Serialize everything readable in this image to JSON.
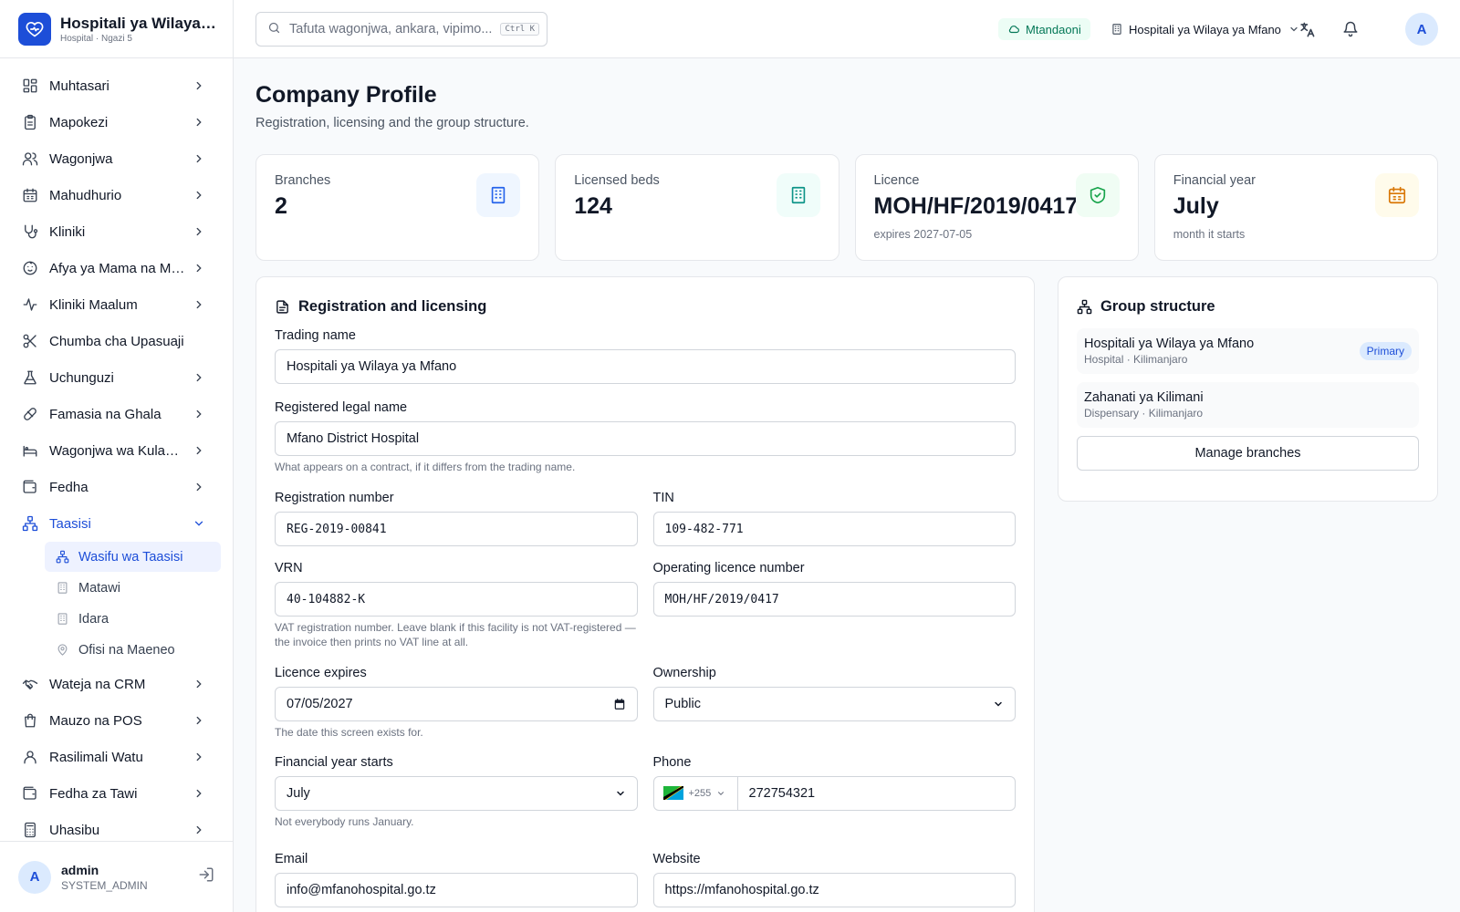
{
  "brand": {
    "name": "Hospitali ya Wilaya ya Mfano",
    "subtitle": "Hospital · Ngazi 5"
  },
  "sidebar": {
    "items": [
      {
        "label": "Muhtasari",
        "icon": "dashboard-icon"
      },
      {
        "label": "Mapokezi",
        "icon": "clipboard-icon"
      },
      {
        "label": "Wagonjwa",
        "icon": "users-icon"
      },
      {
        "label": "Mahudhurio",
        "icon": "calendar-icon"
      },
      {
        "label": "Kliniki",
        "icon": "stethoscope-icon"
      },
      {
        "label": "Afya ya Mama na Mtoto",
        "icon": "baby-icon"
      },
      {
        "label": "Kliniki Maalum",
        "icon": "activity-icon"
      },
      {
        "label": "Chumba cha Upasuaji",
        "icon": "scissors-icon"
      },
      {
        "label": "Uchunguzi",
        "icon": "flask-icon"
      },
      {
        "label": "Famasia na Ghala",
        "icon": "pill-icon"
      },
      {
        "label": "Wagonjwa wa Kulazwa",
        "icon": "bed-icon"
      },
      {
        "label": "Fedha",
        "icon": "wallet-icon"
      },
      {
        "label": "Taasisi",
        "icon": "org-icon"
      }
    ],
    "sub_items": [
      {
        "label": "Wasifu wa Taasisi",
        "icon": "org-icon"
      },
      {
        "label": "Matawi",
        "icon": "building-icon"
      },
      {
        "label": "Idara",
        "icon": "building-icon"
      },
      {
        "label": "Ofisi na Maeneo",
        "icon": "map-pin-icon"
      }
    ],
    "items_after": [
      {
        "label": "Wateja na CRM",
        "icon": "handshake-icon"
      },
      {
        "label": "Mauzo na POS",
        "icon": "shopping-bag-icon"
      },
      {
        "label": "Rasilimali Watu",
        "icon": "user-icon"
      },
      {
        "label": "Fedha za Tawi",
        "icon": "wallet-icon"
      },
      {
        "label": "Uhasibu",
        "icon": "calculator-icon"
      }
    ]
  },
  "user": {
    "initial": "A",
    "name": "admin",
    "role": "SYSTEM_ADMIN"
  },
  "topbar": {
    "search_placeholder": "Tafuta wagonjwa, ankara, vipimo...",
    "search_shortcut": "Ctrl K",
    "status": "Mtandaoni",
    "branch": "Hospitali ya Wilaya ya Mfano",
    "avatar_initial": "A"
  },
  "page": {
    "title": "Company Profile",
    "subtitle": "Registration, licensing and the group structure."
  },
  "stats": [
    {
      "label": "Branches",
      "value": "2",
      "note": "",
      "icon": "building-icon",
      "color": "#2563eb",
      "bg": "#eff6ff"
    },
    {
      "label": "Licensed beds",
      "value": "124",
      "note": "",
      "icon": "building-icon",
      "color": "#0d9488",
      "bg": "#f0fdfa"
    },
    {
      "label": "Licence",
      "value": "MOH/HF/2019/0417",
      "note": "expires 2027-07-05",
      "icon": "shield-check-icon",
      "color": "#16a34a",
      "bg": "#f0fdf4"
    },
    {
      "label": "Financial year",
      "value": "July",
      "note": "month it starts",
      "icon": "calendar-icon",
      "color": "#d97706",
      "bg": "#fffbeb"
    }
  ],
  "registration": {
    "title": "Registration and licensing",
    "trading_name_label": "Trading name",
    "trading_name": "Hospitali ya Wilaya ya Mfano",
    "legal_name_label": "Registered legal name",
    "legal_name": "Mfano District Hospital",
    "legal_name_hint": "What appears on a contract, if it differs from the trading name.",
    "reg_number_label": "Registration number",
    "reg_number": "REG-2019-00841",
    "tin_label": "TIN",
    "tin": "109-482-771",
    "vrn_label": "VRN",
    "vrn": "40-104882-K",
    "vrn_hint": "VAT registration number. Leave blank if this facility is not VAT-registered — the invoice then prints no VAT line at all.",
    "op_licence_label": "Operating licence number",
    "op_licence": "MOH/HF/2019/0417",
    "licence_expires_label": "Licence expires",
    "licence_expires": "07/05/2027",
    "licence_expires_hint": "The date this screen exists for.",
    "ownership_label": "Ownership",
    "ownership": "Public",
    "fy_label": "Financial year starts",
    "fy": "July",
    "fy_hint": "Not everybody runs January.",
    "phone_label": "Phone",
    "phone_cc": "+255",
    "phone": "272754321",
    "email_label": "Email",
    "email": "info@mfanohospital.go.tz",
    "website_label": "Website",
    "website": "https://mfanohospital.go.tz"
  },
  "group": {
    "title": "Group structure",
    "items": [
      {
        "name": "Hospitali ya Wilaya ya Mfano",
        "sub": "Hospital · Kilimanjaro",
        "badge": "Primary"
      },
      {
        "name": "Zahanati ya Kilimani",
        "sub": "Dispensary · Kilimanjaro",
        "badge": ""
      }
    ],
    "button": "Manage branches"
  }
}
